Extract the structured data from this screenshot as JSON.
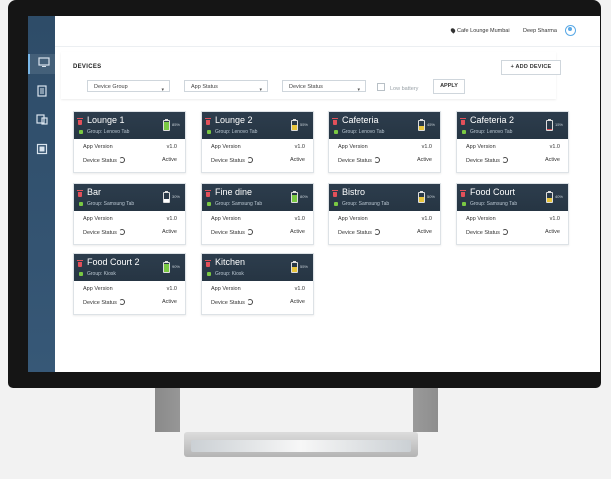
{
  "header": {
    "location": "Cafe Lounge Mumbai",
    "user": "Deep Sharma"
  },
  "filters": {
    "section_label": "DEVICES",
    "device_group": "Device Group",
    "app_status": "App Status",
    "device_status": "Device Status",
    "low_battery": "Low battery",
    "apply": "APPLY",
    "add_device": "+ ADD DEVICE"
  },
  "labels": {
    "app_version": "App Version",
    "device_status": "Device Status"
  },
  "devices": [
    {
      "name": "Lounge 1",
      "group": "Group: Lenovo Tab",
      "battery_color": "#7ac943",
      "battery_level": 0.85,
      "battery_pct": "85%",
      "app_version": "v1.0",
      "status": "Active"
    },
    {
      "name": "Lounge 2",
      "group": "Group: Lenovo Tab",
      "battery_color": "#e7c43b",
      "battery_level": 0.55,
      "battery_pct": "55%",
      "app_version": "v1.0",
      "status": "Active"
    },
    {
      "name": "Cafeteria",
      "group": "Group: Lenovo Tab",
      "battery_color": "#e7c43b",
      "battery_level": 0.45,
      "battery_pct": "45%",
      "app_version": "v1.0",
      "status": "Active"
    },
    {
      "name": "Cafeteria 2",
      "group": "Group: Lenovo Tab",
      "battery_color": "#e2505a",
      "battery_level": 0.15,
      "battery_pct": "15%",
      "app_version": "v1.0",
      "status": "Active"
    },
    {
      "name": "Bar",
      "group": "Group: Samsung Tab",
      "battery_color": "#ffffff",
      "battery_level": 0.3,
      "battery_pct": "30%",
      "app_version": "v1.0",
      "status": "Active"
    },
    {
      "name": "Fine dine",
      "group": "Group: Samsung Tab",
      "battery_color": "#7ac943",
      "battery_level": 0.8,
      "battery_pct": "80%",
      "app_version": "v1.0",
      "status": "Active"
    },
    {
      "name": "Bistro",
      "group": "Group: Samsung Tab",
      "battery_color": "#e7c43b",
      "battery_level": 0.5,
      "battery_pct": "50%",
      "app_version": "v1.0",
      "status": "Active"
    },
    {
      "name": "Food Court",
      "group": "Group: Samsung Tab",
      "battery_color": "#e7c43b",
      "battery_level": 0.4,
      "battery_pct": "40%",
      "app_version": "v1.0",
      "status": "Active"
    },
    {
      "name": "Food Court 2",
      "group": "Group: Kiosk",
      "battery_color": "#7ac943",
      "battery_level": 0.9,
      "battery_pct": "90%",
      "app_version": "v1.0",
      "status": "Active"
    },
    {
      "name": "Kitchen",
      "group": "Group: Kiosk",
      "battery_color": "#e7c43b",
      "battery_level": 0.55,
      "battery_pct": "55%",
      "app_version": "v1.0",
      "status": "Active"
    }
  ]
}
